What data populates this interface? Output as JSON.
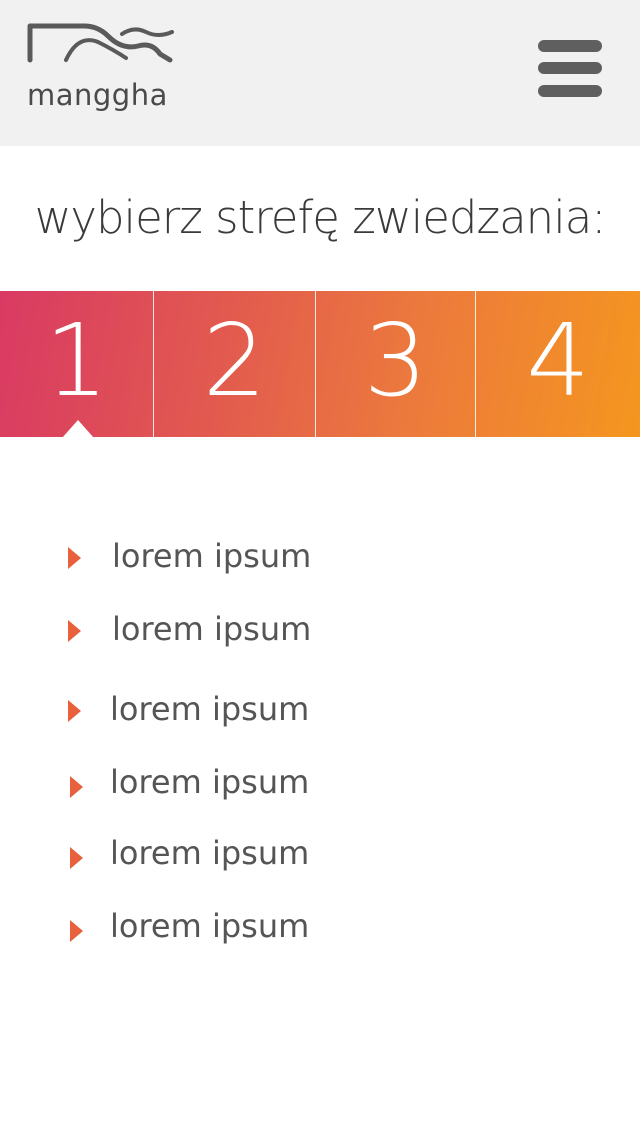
{
  "header": {
    "logo_text": "manggha",
    "menu_icon": "hamburger-menu-icon"
  },
  "title": "wybierz strefę zwiedzania:",
  "zones": [
    {
      "label": "1",
      "selected": true
    },
    {
      "label": "2",
      "selected": false
    },
    {
      "label": "3",
      "selected": false
    },
    {
      "label": "4",
      "selected": false
    }
  ],
  "colors": {
    "gradient_start": "#d93a63",
    "gradient_end": "#f5961f",
    "arrow": "#e8603c",
    "header_bg": "#f1f1f1"
  },
  "items": [
    {
      "label": "lorem ipsum",
      "icon": "play-arrow-icon"
    },
    {
      "label": "lorem ipsum",
      "icon": "play-arrow-icon"
    },
    {
      "label": "lorem ipsum",
      "icon": "play-arrow-icon"
    },
    {
      "label": "lorem ipsum",
      "icon": "play-arrow-icon"
    },
    {
      "label": "lorem ipsum",
      "icon": "play-arrow-icon"
    },
    {
      "label": "lorem ipsum",
      "icon": "play-arrow-icon"
    }
  ]
}
